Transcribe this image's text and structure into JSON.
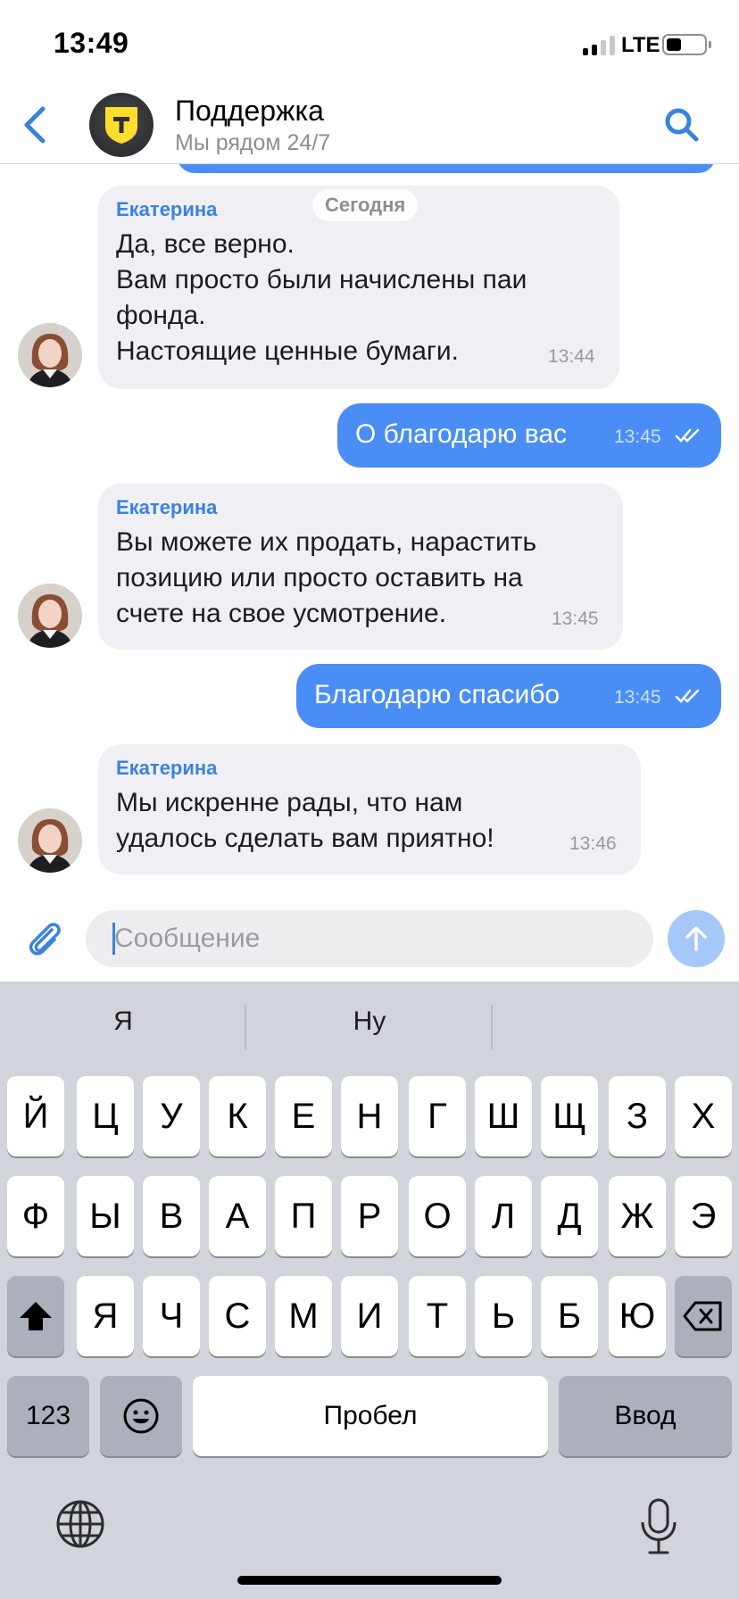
{
  "status_bar": {
    "time": "13:49",
    "network": "LTE",
    "signal_bars": 2,
    "battery_level": 0.3
  },
  "header": {
    "back_icon": "chevron-left-icon",
    "avatar_icon": "tinkoff-shield-logo",
    "title": "Поддержка",
    "subtitle": "Мы рядом 24/7",
    "search_icon": "search-icon"
  },
  "date_chip": "Сегодня",
  "messages": [
    {
      "direction": "in",
      "sender": "Екатерина",
      "lines": [
        "Да, все верно.",
        "Вам просто были начислены паи",
        "фонда.",
        "Настоящие ценные бумаги."
      ],
      "time": "13:44"
    },
    {
      "direction": "out",
      "text": "О благодарю вас",
      "time": "13:45",
      "status": "read"
    },
    {
      "direction": "in",
      "sender": "Екатерина",
      "lines": [
        "Вы можете их продать, нарастить",
        "позицию или просто оставить на",
        "счете на свое усмотрение."
      ],
      "time": "13:45"
    },
    {
      "direction": "out",
      "text": "Благодарю спасибо",
      "time": "13:45",
      "status": "read"
    },
    {
      "direction": "in",
      "sender": "Екатерина",
      "lines": [
        "Мы искренне рады, что нам",
        "удалось сделать вам приятно!"
      ],
      "time": "13:46"
    }
  ],
  "composer": {
    "placeholder": "Сообщение",
    "value": "",
    "attach_icon": "paperclip-icon",
    "send_icon": "arrow-up-icon"
  },
  "keyboard": {
    "suggestions": [
      "Я",
      "Ну",
      ""
    ],
    "row1": [
      "Й",
      "Ц",
      "У",
      "К",
      "Е",
      "Н",
      "Г",
      "Ш",
      "Щ",
      "З",
      "Х"
    ],
    "row2": [
      "Ф",
      "Ы",
      "В",
      "А",
      "П",
      "Р",
      "О",
      "Л",
      "Д",
      "Ж",
      "Э"
    ],
    "row3": [
      "Я",
      "Ч",
      "С",
      "М",
      "И",
      "Т",
      "Ь",
      "Б",
      "Ю"
    ],
    "numbers_label": "123",
    "space_label": "Пробел",
    "return_label": "Ввод",
    "shift_icon": "shift-icon",
    "delete_icon": "backspace-icon",
    "emoji_icon": "emoji-icon",
    "globe_icon": "globe-icon",
    "mic_icon": "microphone-icon"
  },
  "colors": {
    "accent": "#3b82dd",
    "outgoing_bubble": "#4a8ef5",
    "incoming_bubble": "#efeff4",
    "keyboard_bg": "#d1d4da",
    "logo_yellow": "#ffdd2d"
  }
}
